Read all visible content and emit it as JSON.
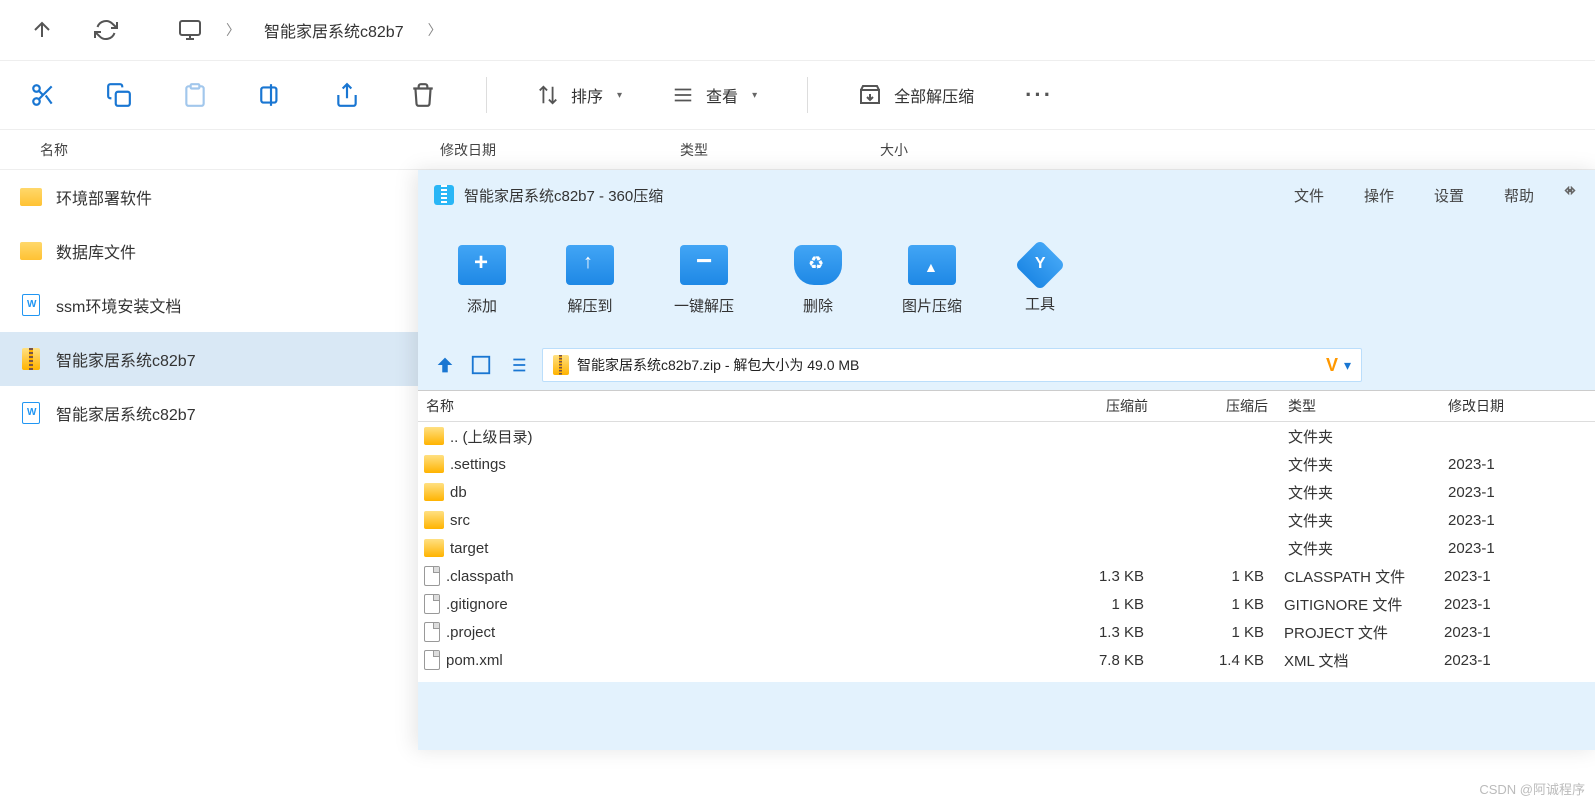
{
  "breadcrumb": {
    "current": "智能家居系统c82b7"
  },
  "toolbar": {
    "sort": "排序",
    "view": "查看",
    "extract_all": "全部解压缩"
  },
  "columns": {
    "name": "名称",
    "date": "修改日期",
    "type": "类型",
    "size": "大小"
  },
  "files": [
    {
      "name": "环境部署软件",
      "icon": "folder"
    },
    {
      "name": "数据库文件",
      "icon": "folder"
    },
    {
      "name": "ssm环境安装文档",
      "icon": "doc"
    },
    {
      "name": "智能家居系统c82b7",
      "icon": "zip",
      "selected": true
    },
    {
      "name": "智能家居系统c82b7",
      "icon": "doc"
    }
  ],
  "zip": {
    "title": "智能家居系统c82b7 - 360压缩",
    "menu": {
      "file": "文件",
      "action": "操作",
      "settings": "设置",
      "help": "帮助"
    },
    "tools": {
      "add": "添加",
      "extract_to": "解压到",
      "quick": "一键解压",
      "delete": "删除",
      "image": "图片压缩",
      "tool": "工具"
    },
    "path_text": "智能家居系统c82b7.zip - 解包大小为 49.0 MB",
    "headers": {
      "name": "名称",
      "before": "压缩前",
      "after": "压缩后",
      "type": "类型",
      "date": "修改日期"
    },
    "rows": [
      {
        "name": ".. (上级目录)",
        "icon": "folder",
        "before": "",
        "after": "",
        "type": "文件夹",
        "date": ""
      },
      {
        "name": ".settings",
        "icon": "folder",
        "before": "",
        "after": "",
        "type": "文件夹",
        "date": "2023-1"
      },
      {
        "name": "db",
        "icon": "folder",
        "before": "",
        "after": "",
        "type": "文件夹",
        "date": "2023-1"
      },
      {
        "name": "src",
        "icon": "folder",
        "before": "",
        "after": "",
        "type": "文件夹",
        "date": "2023-1"
      },
      {
        "name": "target",
        "icon": "folder",
        "before": "",
        "after": "",
        "type": "文件夹",
        "date": "2023-1"
      },
      {
        "name": ".classpath",
        "icon": "file",
        "before": "1.3 KB",
        "after": "1 KB",
        "type": "CLASSPATH 文件",
        "date": "2023-1"
      },
      {
        "name": ".gitignore",
        "icon": "file",
        "before": "1 KB",
        "after": "1 KB",
        "type": "GITIGNORE 文件",
        "date": "2023-1"
      },
      {
        "name": ".project",
        "icon": "file",
        "before": "1.3 KB",
        "after": "1 KB",
        "type": "PROJECT 文件",
        "date": "2023-1"
      },
      {
        "name": "pom.xml",
        "icon": "file",
        "before": "7.8 KB",
        "after": "1.4 KB",
        "type": "XML 文档",
        "date": "2023-1"
      }
    ]
  },
  "watermark": "CSDN @阿诚程序"
}
